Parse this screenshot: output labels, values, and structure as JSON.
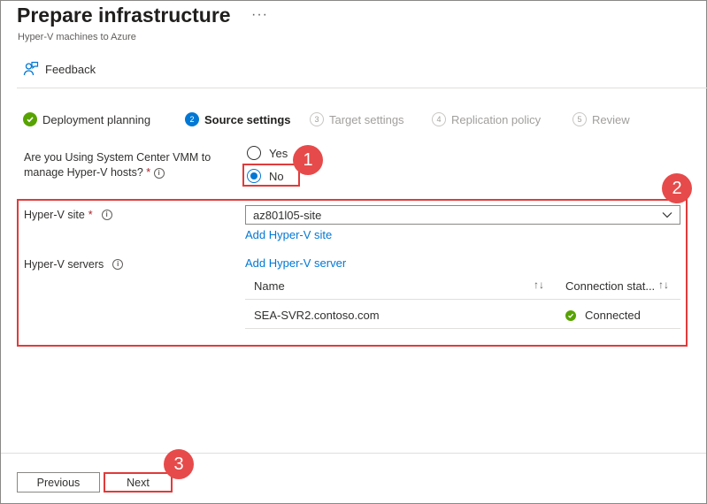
{
  "header": {
    "title": "Prepare infrastructure",
    "more": "···",
    "subtitle": "Hyper-V machines to Azure"
  },
  "toolbar": {
    "feedback_label": "Feedback"
  },
  "steps": [
    {
      "label": "Deployment planning",
      "number": "",
      "state": "done"
    },
    {
      "label": "Source settings",
      "number": "2",
      "state": "active"
    },
    {
      "label": "Target settings",
      "number": "3",
      "state": "pending"
    },
    {
      "label": "Replication policy",
      "number": "4",
      "state": "pending"
    },
    {
      "label": "Review",
      "number": "5",
      "state": "pending"
    }
  ],
  "question": {
    "label": "Are you Using System Center VMM to manage Hyper-V hosts?",
    "required_mark": "*",
    "options": [
      {
        "label": "Yes",
        "selected": false
      },
      {
        "label": "No",
        "selected": true
      }
    ]
  },
  "hyperv_site": {
    "label": "Hyper-V site",
    "required_mark": "*",
    "value": "az801l05-site",
    "add_link": "Add Hyper-V site"
  },
  "hyperv_servers": {
    "label": "Hyper-V servers",
    "add_link": "Add Hyper-V server",
    "columns": [
      "Name",
      "Connection stat..."
    ],
    "rows": [
      {
        "name": "SEA-SVR2.contoso.com",
        "status": "Connected"
      }
    ]
  },
  "callouts": [
    "1",
    "2",
    "3"
  ],
  "footer": {
    "previous_label": "Previous",
    "next_label": "Next"
  },
  "colors": {
    "accent": "#0078d4",
    "success": "#57a300",
    "annotation": "#e74a4a"
  },
  "icons": {
    "feedback": "feedback-person-icon",
    "info": "info-icon",
    "chevron": "chevron-down-icon",
    "sort": "sort-icon",
    "status_ok": "check-circle-icon"
  }
}
